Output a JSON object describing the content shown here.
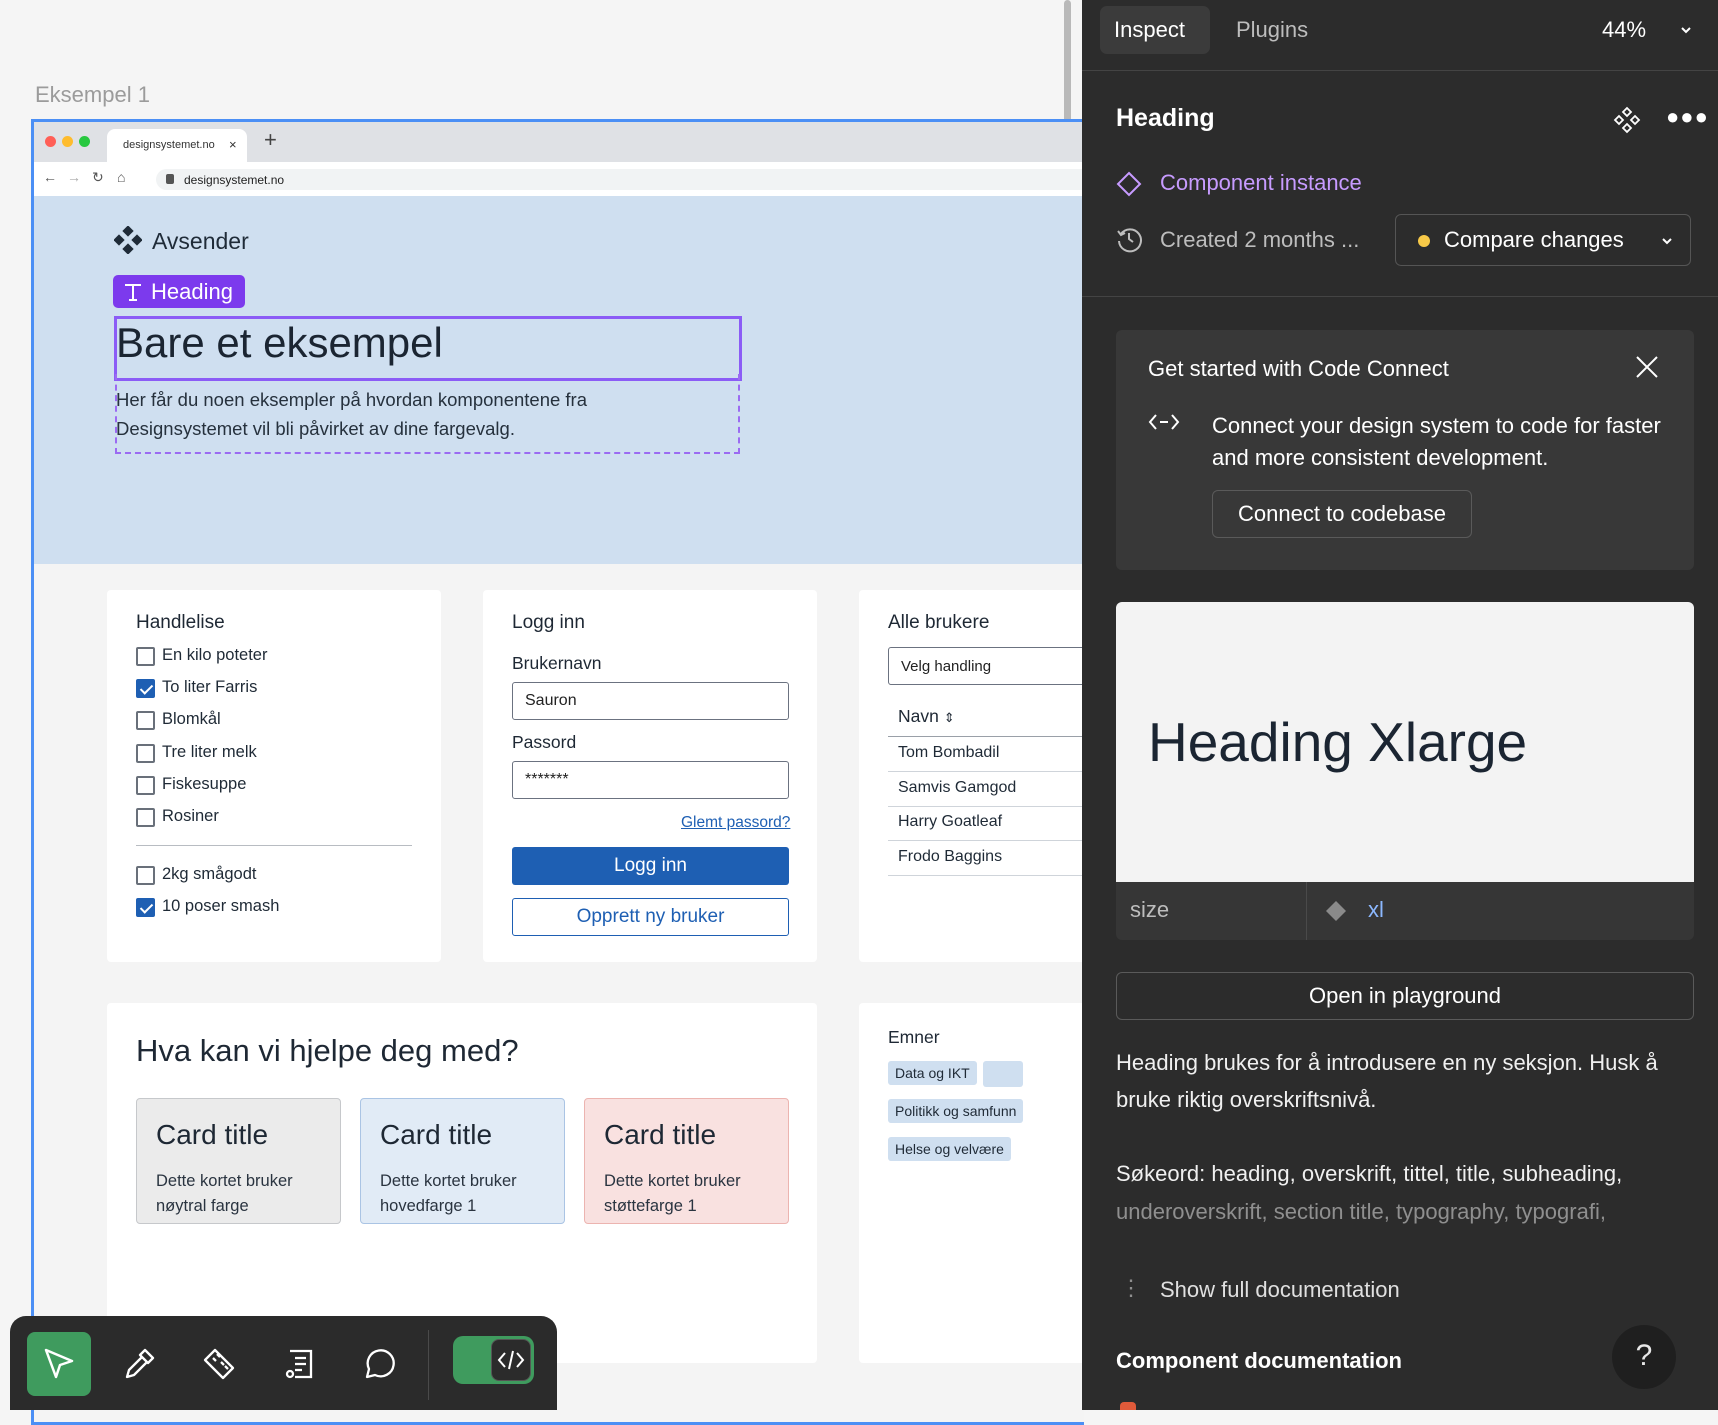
{
  "canvas": {
    "frame_label": "Eksempel 1",
    "browser": {
      "tab_title": "designsystemet.no",
      "tab_close": "×",
      "new_tab": "+",
      "url": "designsystemet.no"
    },
    "hero": {
      "brand": "Avsender",
      "selection_badge": "Heading",
      "title": "Bare et eksempel",
      "text": "Her får du noen eksempler på hvordan komponentene fra Designsystemet vil bli påvirket av dine fargevalg."
    },
    "shopping": {
      "title": "Handlelise",
      "items": [
        {
          "label": "En kilo poteter",
          "checked": false
        },
        {
          "label": "To liter Farris",
          "checked": true
        },
        {
          "label": "Blomkål",
          "checked": false
        },
        {
          "label": "Tre liter melk",
          "checked": false
        },
        {
          "label": "Fiskesuppe",
          "checked": false
        },
        {
          "label": "Rosiner",
          "checked": false
        }
      ],
      "items2": [
        {
          "label": "2kg smågodt",
          "checked": false
        },
        {
          "label": "10 poser smash",
          "checked": true
        }
      ]
    },
    "login": {
      "title": "Logg inn",
      "username_label": "Brukernavn",
      "username_value": "Sauron",
      "password_label": "Passord",
      "password_value": "*******",
      "forgot_link": "Glemt passord?",
      "login_button": "Logg inn",
      "create_button": "Opprett ny bruker"
    },
    "users": {
      "title": "Alle brukere",
      "select_value": "Velg handling",
      "column_header": "Navn",
      "rows": [
        "Tom Bombadil",
        "Samvis Gamgod",
        "Harry Goatleaf",
        "Frodo Baggins"
      ]
    },
    "help": {
      "title": "Hva kan vi hjelpe deg med?",
      "cards": [
        {
          "title": "Card title",
          "body": "Dette kortet bruker nøytral farge"
        },
        {
          "title": "Card title",
          "body": "Dette kortet bruker hovedfarge 1"
        },
        {
          "title": "Card title",
          "body": "Dette kortet bruker støttefarge 1"
        }
      ]
    },
    "topics": {
      "title": "Emner",
      "chips": [
        "Data og IKT",
        "Politikk og samfunn",
        "Helse og velvære"
      ]
    }
  },
  "panel": {
    "tabs": [
      "Inspect",
      "Plugins"
    ],
    "zoom": "44%",
    "layer_name": "Heading",
    "component_instance": "Component instance",
    "created": "Created 2 months ...",
    "compare_changes": "Compare changes",
    "code_connect": {
      "title": "Get started with Code Connect",
      "text": "Connect your design system to code for faster and more consistent development.",
      "button": "Connect to codebase"
    },
    "preview_heading": "Heading Xlarge",
    "property": {
      "name": "size",
      "value": "xl"
    },
    "playground_button": "Open in playground",
    "description": "Heading brukes for å introdusere en ny seksjon. Husk å bruke riktig overskriftsnivå.",
    "keywords_1": "Søkeord: heading, overskrift, tittel, title, subheading,",
    "keywords_2": "underoverskrift, section title, typography, typografi,",
    "show_docs": "Show full documentation",
    "component_docs": "Component documentation",
    "help": "?"
  },
  "colors": {
    "accent": "#1e5fb3",
    "selection": "#7c3aed",
    "panel_bg": "#2c2c2c",
    "dev_mode_green": "#3f9b5e",
    "component_purple": "#c79bff"
  },
  "icons": [
    "cursor-icon",
    "eyedropper-icon",
    "ruler-icon",
    "annotation-icon",
    "comment-icon",
    "code-icon",
    "component-icon",
    "more-icon",
    "history-icon",
    "close-icon"
  ]
}
